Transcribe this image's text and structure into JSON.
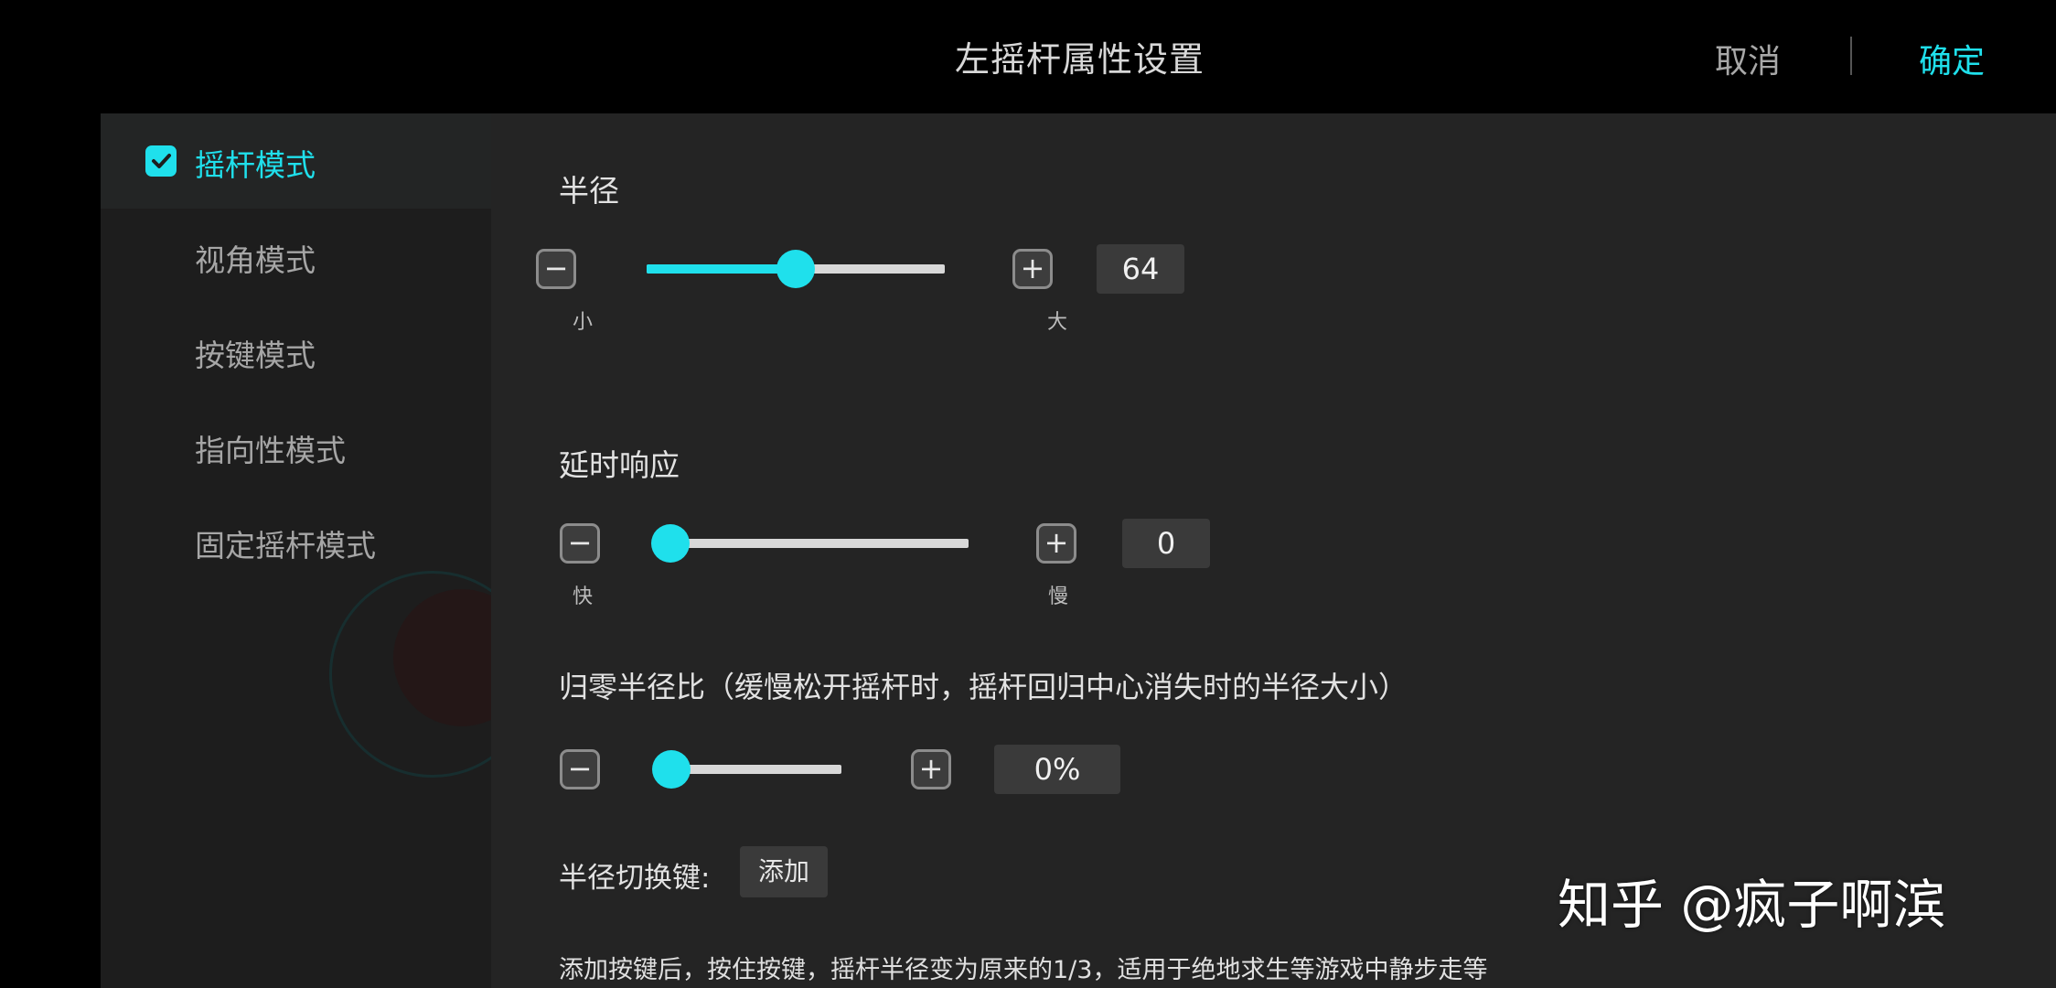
{
  "header": {
    "title": "左摇杆属性设置",
    "cancel_label": "取消",
    "confirm_label": "确定"
  },
  "sidebar": {
    "items": [
      {
        "label": "摇杆模式",
        "selected": true
      },
      {
        "label": "视角模式",
        "selected": false
      },
      {
        "label": "按键模式",
        "selected": false
      },
      {
        "label": "指向性模式",
        "selected": false
      },
      {
        "label": "固定摇杆模式",
        "selected": false
      }
    ]
  },
  "settings": {
    "radius": {
      "label": "半径",
      "min_caption": "小",
      "max_caption": "大",
      "value": "64",
      "level": 0.5
    },
    "delay": {
      "label": "延时响应",
      "min_caption": "快",
      "max_caption": "慢",
      "value": "0",
      "level": 0.0
    },
    "reset_ratio": {
      "label": "归零半径比（缓慢松开摇杆时，摇杆回归中心消失时的半径大小）",
      "value": "0%",
      "level": 0.0
    },
    "radius_switch": {
      "label": "半径切换键:",
      "add_label": "添加",
      "description": "添加按键后，按住按键，摇杆半径变为原来的1/3，适用于绝地求生等游戏中静步走等"
    }
  },
  "watermark": "知乎 @疯子啊滨",
  "colors": {
    "accent": "#1fe0ec",
    "background": "#242424",
    "sidebar": "#1d1d1d"
  }
}
